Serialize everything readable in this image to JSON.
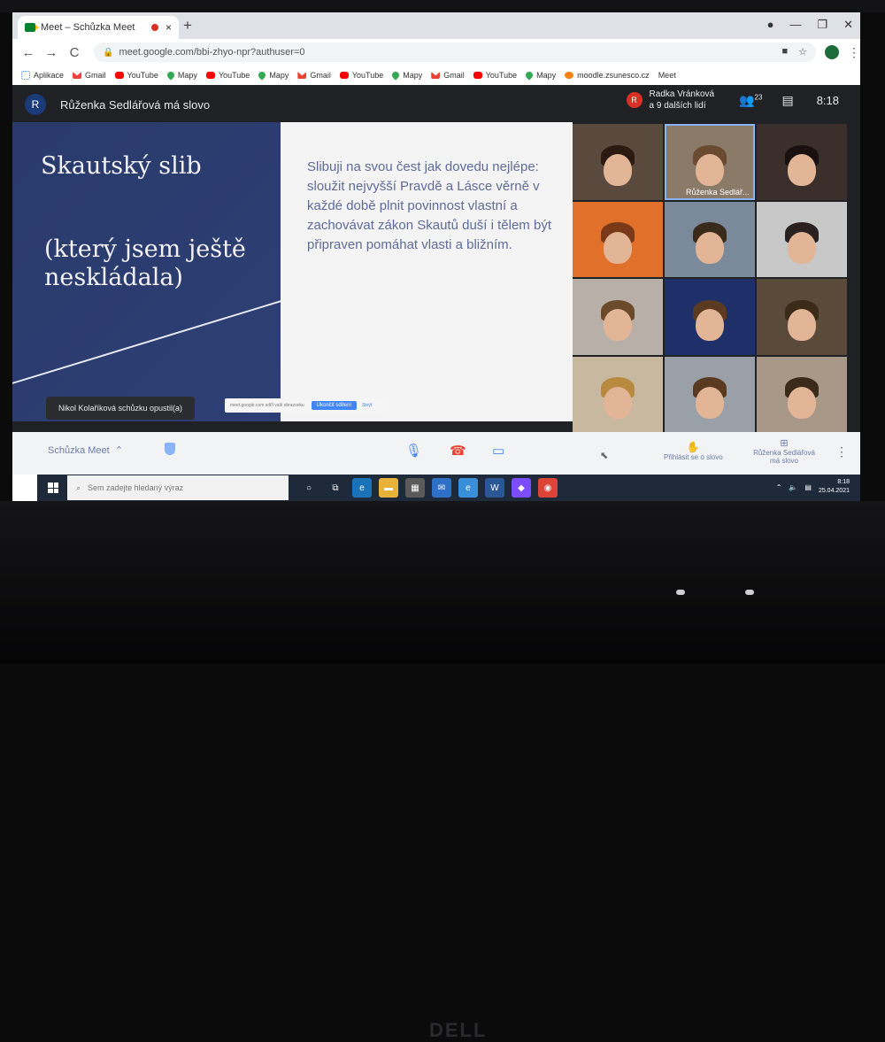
{
  "browser": {
    "tab_title": "Meet – Schůzka Meet",
    "tab_close": "×",
    "new_tab": "+",
    "url": "meet.google.com/bbi-zhyo-npr?authuser=0",
    "nav_back": "←",
    "nav_forward": "→",
    "nav_reload": "C",
    "bookmarks": [
      "Aplikace",
      "Gmail",
      "YouTube",
      "Mapy",
      "YouTube",
      "Mapy",
      "Gmail",
      "YouTube",
      "Mapy",
      "Gmail",
      "YouTube",
      "Mapy",
      "moodle.zsunesco.cz",
      "Meet"
    ],
    "bookmark_icons": [
      "apps",
      "gmail",
      "yt",
      "maps",
      "yt",
      "maps",
      "gmail",
      "yt",
      "maps",
      "gmail",
      "yt",
      "maps",
      "moodle",
      "meet"
    ]
  },
  "meet": {
    "pinned_avatar": "R",
    "pinned_speaker": "Růženka Sedlářová má slovo",
    "participant_avatar": "R",
    "participant_line1": "Radka Vránková",
    "participant_line2": "a 9 dalších lidí",
    "participant_count": "23",
    "clock": "8:18",
    "active_tile_label": "Růženka Sedlář...",
    "notice": "Nikol Kolaříková schůzku opustil(a)",
    "popup_text": "meet.google.com sdílí vaši obrazovku",
    "popup_button": "Ukončit sdílení",
    "popup_hide": "Skrýt",
    "meeting_name": "Schůzka Meet",
    "raise_hand": "Přihlásit se o slovo",
    "presenting_line1": "Růženka Sedlářová",
    "presenting_line2": "má slovo"
  },
  "slide": {
    "title": "Skautský slib",
    "subtitle": "(který jsem ještě nesklá­dala)",
    "body": "Slibuji na svou čest jak dovedu nejlépe: sloužit nejvyšší Pravdě a Lásce věrně v každé době plnit povinnost  vlastní a zachovávat zákon Skautů duší i tělem být připraven pomáhat vlasti a bližním."
  },
  "taskbar": {
    "search_placeholder": "Sem zadejte hledaný výraz",
    "time": "8:18",
    "date": "25.04.2021"
  },
  "colors": {
    "slide_blue": "#2d3f74",
    "meet_dark": "#202124",
    "accent": "#8ab4f8",
    "hangup": "#ea4335"
  },
  "hardware": {
    "brand": "DELL"
  }
}
